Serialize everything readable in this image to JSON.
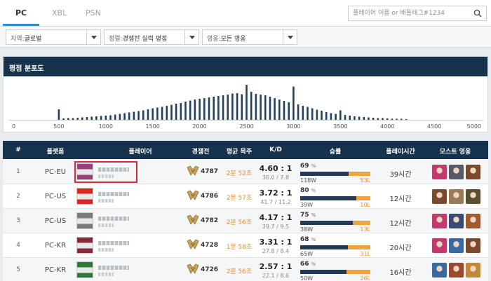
{
  "platform_tabs": [
    "PC",
    "XBL",
    "PSN"
  ],
  "search": {
    "placeholder": "플레이어 이름 or 배틀태그#1234"
  },
  "filters": [
    {
      "key": "지역:",
      "value": "글로벌"
    },
    {
      "key": "정렬:",
      "value": "경쟁전 실력 평점"
    },
    {
      "key": "영웅:",
      "value": "모든 영웅"
    }
  ],
  "distribution": {
    "title": "평점 분포도",
    "ticks": [
      "0",
      "500",
      "1000",
      "1500",
      "2000",
      "2500",
      "3000",
      "3500",
      "4000",
      "4500",
      "5000"
    ]
  },
  "chart_data": {
    "type": "bar",
    "title": "평점 분포도",
    "x_range": [
      0,
      5000
    ],
    "bin_width": 50,
    "x": [
      500,
      550,
      600,
      650,
      700,
      750,
      800,
      850,
      900,
      950,
      1000,
      1050,
      1100,
      1150,
      1200,
      1250,
      1300,
      1350,
      1400,
      1450,
      1500,
      1550,
      1600,
      1650,
      1700,
      1750,
      1800,
      1850,
      1900,
      1950,
      2000,
      2050,
      2100,
      2150,
      2200,
      2250,
      2300,
      2350,
      2400,
      2450,
      2500,
      2550,
      2600,
      2650,
      2700,
      2750,
      2800,
      2850,
      2900,
      2950,
      3000,
      3050,
      3100,
      3150,
      3200,
      3250,
      3300,
      3350,
      3400,
      3450,
      3500,
      3550,
      3600,
      3650,
      3700,
      3750,
      3800,
      3850,
      3900,
      3950,
      4000,
      4050,
      4100,
      4150,
      4200
    ],
    "values": [
      30,
      4,
      5,
      5,
      6,
      7,
      8,
      9,
      10,
      11,
      12,
      13,
      15,
      17,
      19,
      21,
      23,
      25,
      27,
      30,
      33,
      35,
      37,
      40,
      43,
      46,
      48,
      52,
      55,
      58,
      60,
      62,
      64,
      66,
      68,
      70,
      72,
      75,
      76,
      73,
      100,
      80,
      74,
      72,
      70,
      66,
      62,
      58,
      54,
      50,
      95,
      44,
      40,
      37,
      33,
      29,
      26,
      22,
      19,
      17,
      27,
      14,
      12,
      10,
      9,
      8,
      7,
      6,
      5,
      5,
      4,
      3,
      3,
      3,
      2
    ]
  },
  "leaderboard": {
    "columns": [
      "#",
      "플랫폼",
      "플레이어",
      "경쟁전",
      "평균 목주",
      "K/D",
      "승률",
      "플레이시간",
      "모스트 영웅"
    ],
    "rows": [
      {
        "rank": "1",
        "platform": "PC-EU",
        "sr": "4787",
        "duration": "2분 52초",
        "kd": "4.60 : 1",
        "kd_detail": "36.0 / 7.8",
        "winrate": "69",
        "wins": "118W",
        "losses": "53L",
        "hours": "39시간",
        "highlighted": true,
        "avatar_color": "#9b3f7c"
      },
      {
        "rank": "2",
        "platform": "PC-US",
        "sr": "4786",
        "duration": "2분 57초",
        "kd": "3.72 : 1",
        "kd_detail": "41.7 / 11.2",
        "winrate": "80",
        "wins": "39W",
        "losses": "10L",
        "hours": "12시간",
        "highlighted": false,
        "avatar_color": "#d8271f"
      },
      {
        "rank": "3",
        "platform": "PC-US",
        "sr": "4782",
        "duration": "2분 56초",
        "kd": "4.17 : 1",
        "kd_detail": "39.7 / 9.5",
        "winrate": "75",
        "wins": "38W",
        "losses": "13L",
        "hours": "12시간",
        "highlighted": false,
        "avatar_color": "#7b7b7b"
      },
      {
        "rank": "4",
        "platform": "PC-KR",
        "sr": "4728",
        "duration": "1분 58초",
        "kd": "3.31 : 1",
        "kd_detail": "27.8 / 8.4",
        "winrate": "68",
        "wins": "65W",
        "losses": "31L",
        "hours": "20시간",
        "highlighted": false,
        "avatar_color": "#8a2a3c"
      },
      {
        "rank": "5",
        "platform": "PC-KR",
        "sr": "4726",
        "duration": "2분 56초",
        "kd": "2.57 : 1",
        "kd_detail": "22.1 / 8.6",
        "winrate": "66",
        "wins": "50W",
        "losses": "26L",
        "hours": "16시간",
        "highlighted": false,
        "avatar_color": "#2f7a3a"
      }
    ]
  },
  "hero_colors": [
    [
      "#c03a6d",
      "#555a66",
      "#7a4a2e"
    ],
    [
      "#7a4a2e",
      "#9a7b58",
      "#5a5030"
    ],
    [
      "#c03a6d",
      "#3b4a73",
      "#a05a2f"
    ],
    [
      "#c03a6d",
      "#3b6aa0",
      "#7a4a2e"
    ],
    [
      "#3b6aa0",
      "#9a4a2e",
      "#c08a3a"
    ]
  ]
}
